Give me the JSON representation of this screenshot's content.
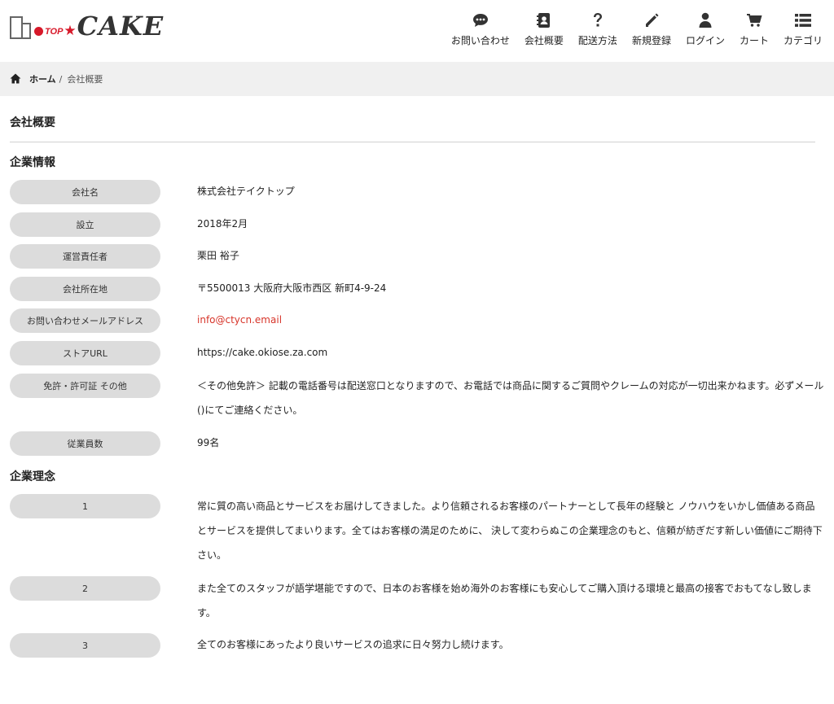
{
  "brand": {
    "top": "TOP",
    "name": "CAKE"
  },
  "nav": [
    {
      "label": "お問い合わせ",
      "icon": "chat-icon"
    },
    {
      "label": "会社概要",
      "icon": "contact-book-icon"
    },
    {
      "label": "配送方法",
      "icon": "question-icon"
    },
    {
      "label": "新規登録",
      "icon": "pencil-icon"
    },
    {
      "label": "ログイン",
      "icon": "user-icon"
    },
    {
      "label": "カート",
      "icon": "cart-icon"
    },
    {
      "label": "カテゴリ",
      "icon": "list-icon"
    }
  ],
  "breadcrumb": {
    "home": "ホーム",
    "separator": "/",
    "current": "会社概要"
  },
  "page": {
    "title": "会社概要",
    "company_section": "企業情報",
    "philosophy_section": "企業理念"
  },
  "company_info": [
    {
      "label": "会社名",
      "value": "株式会社テイクトップ"
    },
    {
      "label": "設立",
      "value": "2018年2月"
    },
    {
      "label": "運営責任者",
      "value": "栗田 裕子"
    },
    {
      "label": "会社所在地",
      "value": "〒5500013 大阪府大阪市西区 新町4-9-24"
    },
    {
      "label": "お問い合わせメールアドレス",
      "value": "info@ctycn.email"
    },
    {
      "label": "ストアURL",
      "value": "https://cake.okiose.za.com"
    },
    {
      "label": "免許・許可証 その他",
      "value": "＜その他免許＞ 記載の電話番号は配送窓口となりますので、お電話では商品に関するご質問やクレームの対応が一切出来かねます。必ずメール()にてご連絡ください。"
    },
    {
      "label": "従業員数",
      "value": "99名"
    }
  ],
  "philosophy": [
    {
      "label": "1",
      "value": "常に質の高い商品とサービスをお届けしてきました。より信頼されるお客様のパートナーとして長年の経験と ノウハウをいかし価値ある商品とサービスを提供してまいります。全てはお客様の満足のために、 決して変わらぬこの企業理念のもと、信頼が紡ぎだす新しい価値にご期待下さい。"
    },
    {
      "label": "2",
      "value": "また全てのスタッフが語学堪能ですので、日本のお客様を始め海外のお客様にも安心してご購入頂ける環境と最高の接客でおもてなし致します。"
    },
    {
      "label": "3",
      "value": "全てのお客様にあったより良いサービスの追求に日々努力し続けます。"
    }
  ],
  "colors": {
    "accent_red": "#d7192a",
    "link_red": "#d7352a",
    "pill_gray": "#dcdcdc",
    "breadcrumb_bg": "#f0f0f0"
  }
}
